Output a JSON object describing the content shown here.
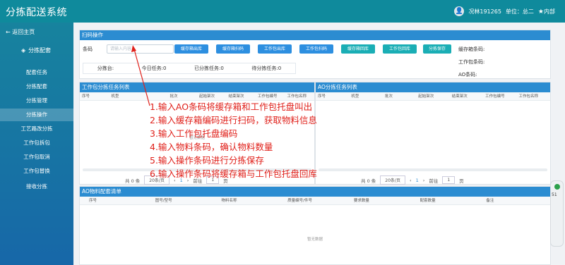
{
  "app": {
    "title": "分拣配送系统"
  },
  "user": {
    "name": "况林191265",
    "unit": "单位：总二",
    "scope": "内部"
  },
  "sidebar": {
    "back": "← 返回主页",
    "section": "分拣配套",
    "items": [
      {
        "label": "配套任务",
        "active": false
      },
      {
        "label": "分拣配套",
        "active": false
      },
      {
        "label": "分拣管理",
        "active": false
      },
      {
        "label": "分拣操作",
        "active": true
      },
      {
        "label": "工艺路改分拣",
        "active": false
      },
      {
        "label": "工作包拆包",
        "active": false
      },
      {
        "label": "工作包取消",
        "active": false
      },
      {
        "label": "工作包替换",
        "active": false
      },
      {
        "label": "接收分拣",
        "active": false
      }
    ]
  },
  "scan": {
    "title": "扫码操作",
    "barcode_label": "条码",
    "placeholder": "请输入内容",
    "buttons": [
      "缓存箱出库",
      "缓存箱扫码",
      "工作包出库",
      "工作包扫码",
      "缓存箱回库",
      "工作包回库",
      "分拣保存"
    ],
    "info": {
      "cache_box": "缓存箱条码:",
      "work_pkg": "工作包条码:",
      "ao": "AO条码:"
    },
    "stats": {
      "sorter": "分拣台:",
      "today": "今日任务:0",
      "sorted": "已分拣任务:0",
      "pending": "待分拣任务:0"
    }
  },
  "left_table": {
    "title": "工作包分拣任务列表",
    "columns": [
      "序号",
      "机型",
      "",
      "批次",
      "起始架次",
      "结束架次",
      "工作包编号",
      "工作包名称"
    ],
    "empty": "暂无数据",
    "pager": {
      "total": "共 0 条",
      "size": "20条/页",
      "page": "1",
      "goto_label": "前往",
      "goto_value": "1",
      "goto_unit": "页"
    }
  },
  "right_table": {
    "title": "AO分拣任务列表",
    "columns": [
      "序号",
      "机型",
      "批次",
      "起始架次",
      "结束架次",
      "工作包编号",
      "工作包名称"
    ],
    "pager": {
      "total": "共 0 条",
      "size": "20条/页",
      "page": "1",
      "goto_label": "前往",
      "goto_value": "1",
      "goto_unit": "页"
    }
  },
  "config": {
    "title": "AO物料配套清单",
    "columns": [
      "序号",
      "图号/型号",
      "物料名称",
      "质量编号/件号",
      "要求数量",
      "配套数量",
      "备注"
    ],
    "empty": "暂无数据"
  },
  "instructions": [
    "1.输入AO条码将缓存箱和工作包托盘叫出",
    "2.输入缓存箱编码进行扫码，获取物料信息",
    "3.输入工作包托盘编码",
    "4.输入物料条码，确认物料数量",
    "5.输入操作条码进行分拣保存",
    "6.输入操作条码将缓存箱与工作包托盘回库"
  ],
  "widget": {
    "value": "51"
  }
}
